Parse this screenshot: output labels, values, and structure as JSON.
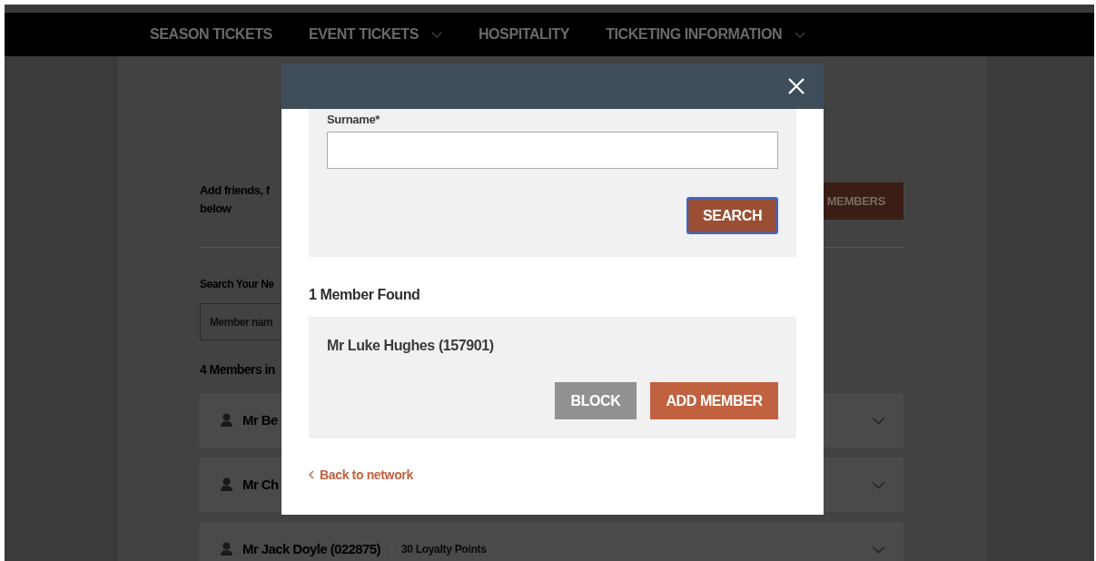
{
  "nav": [
    {
      "label": "SEASON TICKETS",
      "has_dropdown": false
    },
    {
      "label": "EVENT TICKETS",
      "has_dropdown": true
    },
    {
      "label": "HOSPITALITY",
      "has_dropdown": false
    },
    {
      "label": "TICKETING INFORMATION",
      "has_dropdown": true
    }
  ],
  "background": {
    "intro_lines": [
      "Add friends, f",
      "below"
    ],
    "add_button": "MEMBERS",
    "search_label": "Search Your Ne",
    "search_placeholder": "Member nam",
    "count": "4 Members in",
    "members": [
      {
        "name": "Mr Be"
      },
      {
        "name": "Mr Ch"
      },
      {
        "name": "Mr Jack Doyle (022875)",
        "points": "30 Loyalty Points"
      }
    ]
  },
  "modal": {
    "surname_label": "Surname*",
    "search_button": "SEARCH",
    "search_focused": true,
    "results_title": "1 Member Found",
    "result": {
      "name": "Mr Luke Hughes (157901)",
      "actions": [
        {
          "label": "BLOCK",
          "kind": "secondary"
        },
        {
          "label": "ADD MEMBER",
          "kind": "primary"
        }
      ]
    },
    "back_link": "Back to network"
  }
}
